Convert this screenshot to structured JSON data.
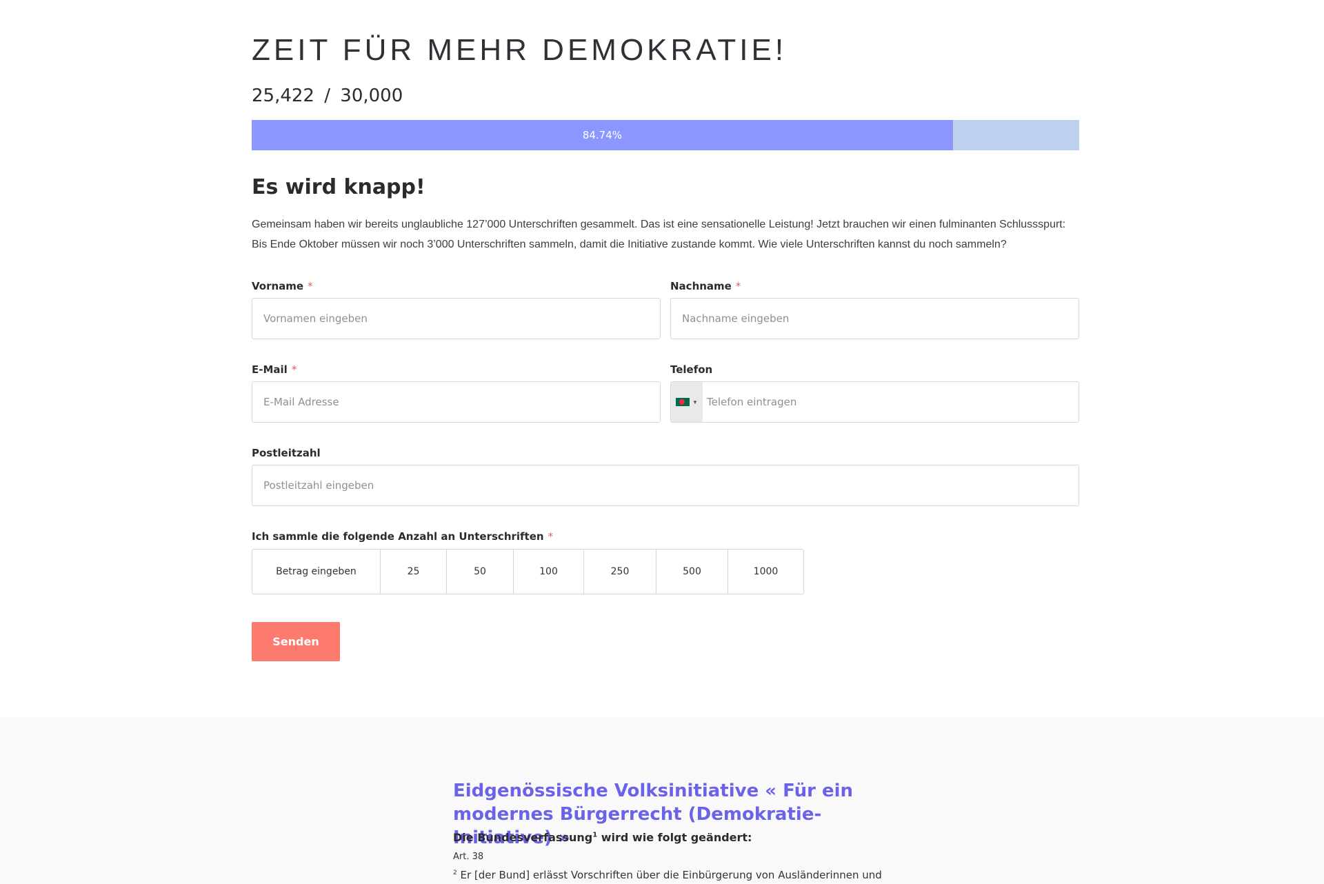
{
  "hero": {
    "title": "ZEIT FÜR MEHR DEMOKRATIE!",
    "count_current": "25,422",
    "count_separator": "/",
    "count_goal": "30,000",
    "progress_label": "84.74%",
    "progress_value": 0.8474
  },
  "colors": {
    "progress_fill": "#8c96ff",
    "progress_track": "#bdd1ee",
    "submit": "#fd7a6e",
    "required": "#e4605f",
    "footer_title": "#6a63ea"
  },
  "intro": {
    "heading": "Es wird knapp!",
    "text": "Gemeinsam haben wir bereits unglaubliche 127’000 Unterschriften gesammelt. Das ist eine sensationelle Leistung! Jetzt brauchen wir einen fulminanten Schlussspurt: Bis Ende Oktober müssen wir noch 3’000 Unterschriften sammeln, damit die Initiative zustande kommt. Wie viele Unterschriften kannst du noch sammeln?"
  },
  "form": {
    "required_mark": "*",
    "firstname": {
      "label": "Vorname",
      "placeholder": "Vornamen eingeben"
    },
    "lastname": {
      "label": "Nachname",
      "placeholder": "Nachname eingeben"
    },
    "email": {
      "label": "E-Mail",
      "placeholder": "E-Mail Adresse"
    },
    "phone": {
      "label": "Telefon",
      "placeholder": "Telefon eintragen",
      "flag_icon": "bangladesh-flag-icon"
    },
    "zip": {
      "label": "Postleitzahl",
      "placeholder": "Postleitzahl eingeben"
    },
    "amount": {
      "label": "Ich sammle die folgende Anzahl an Unterschriften",
      "custom_label": "Betrag eingeben",
      "options": [
        "25",
        "50",
        "100",
        "250",
        "500",
        "1000"
      ]
    },
    "submit_label": "Senden"
  },
  "initiative": {
    "title": "Eidgenössische Volksinitiative « Für ein modernes Bürgerrecht (Demokratie-Initiative) »",
    "subtitle_prefix": "Die Bundesverfassung",
    "subtitle_sup": "1",
    "subtitle_suffix": " wird wie folgt geändert:",
    "article": "Art. 38",
    "paragraph_sup": "2",
    "paragraph_text": " Er [der Bund] erlässt Vorschriften über die Einbürgerung von Ausländerinnen und"
  }
}
